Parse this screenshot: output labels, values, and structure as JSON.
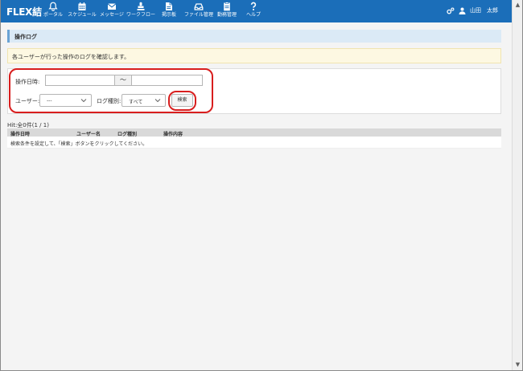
{
  "header": {
    "brand": "FLEX結",
    "nav": [
      {
        "label": "ポータル",
        "icon": "bell-icon"
      },
      {
        "label": "スケジュール",
        "icon": "calendar-icon"
      },
      {
        "label": "メッセージ",
        "icon": "envelope-icon"
      },
      {
        "label": "ワークフロー",
        "icon": "stamp-icon"
      },
      {
        "label": "掲示板",
        "icon": "board-icon"
      },
      {
        "label": "ファイル管理",
        "icon": "inbox-icon"
      },
      {
        "label": "勤務管理",
        "icon": "clipboard-icon"
      },
      {
        "label": "ヘルプ",
        "icon": "question-icon"
      }
    ],
    "user_name": "山田　太郎"
  },
  "page": {
    "title": "操作ログ",
    "notice": "各ユーザーが行った操作のログを確認します。"
  },
  "search": {
    "datetime_label": "操作日時:",
    "date_from": "",
    "date_to": "",
    "range_separator": "～",
    "user_label": "ユーザー:",
    "user_value": "---",
    "logtype_label": "ログ種別:",
    "logtype_value": "すべて",
    "search_button": "検索"
  },
  "results": {
    "hit_text": "Hit:全0件(1 / 1)",
    "columns": [
      "操作日時",
      "ユーザー名",
      "ログ種別",
      "操作内容"
    ],
    "empty_message": "検索条件を設定して、「検索」ボタンをクリックしてください。"
  },
  "colors": {
    "header_bg": "#1b6eb9",
    "highlight": "#d81e1e",
    "title_bg": "#dbeaf6",
    "notice_bg": "#fdf8e2"
  }
}
